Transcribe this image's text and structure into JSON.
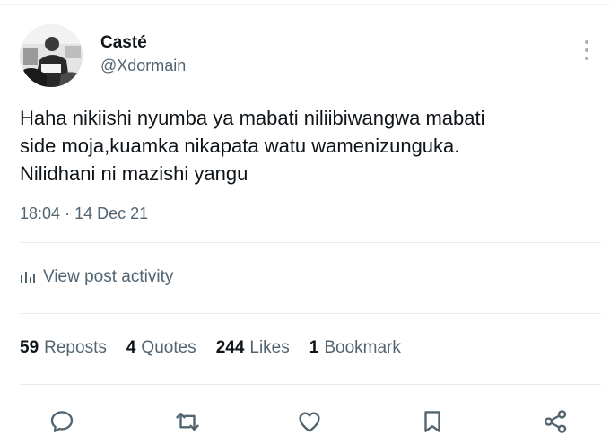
{
  "user": {
    "display_name": "Casté",
    "handle": "@Xdormain",
    "avatar_icon": "profile-photo"
  },
  "tweet": {
    "text": "Haha nikiishi nyumba ya mabati niliibiwangwa mabati\nside moja,kuamka nikapata watu wamenizunguka.\nNilidhani ni mazishi yangu",
    "time": "18:04",
    "separator": "·",
    "date": "14 Dec 21"
  },
  "activity": {
    "icon": "analytics-icon",
    "label": "View post activity"
  },
  "stats": [
    {
      "count": "59",
      "label": "Reposts"
    },
    {
      "count": "4",
      "label": "Quotes"
    },
    {
      "count": "244",
      "label": "Likes"
    },
    {
      "count": "1",
      "label": "Bookmark"
    }
  ],
  "actions": [
    {
      "icon": "reply-icon"
    },
    {
      "icon": "repost-icon"
    },
    {
      "icon": "like-icon"
    },
    {
      "icon": "bookmark-icon"
    },
    {
      "icon": "share-icon"
    }
  ],
  "colors": {
    "text": "#0f1419",
    "secondary": "#536471",
    "divider": "#e7ebed"
  }
}
